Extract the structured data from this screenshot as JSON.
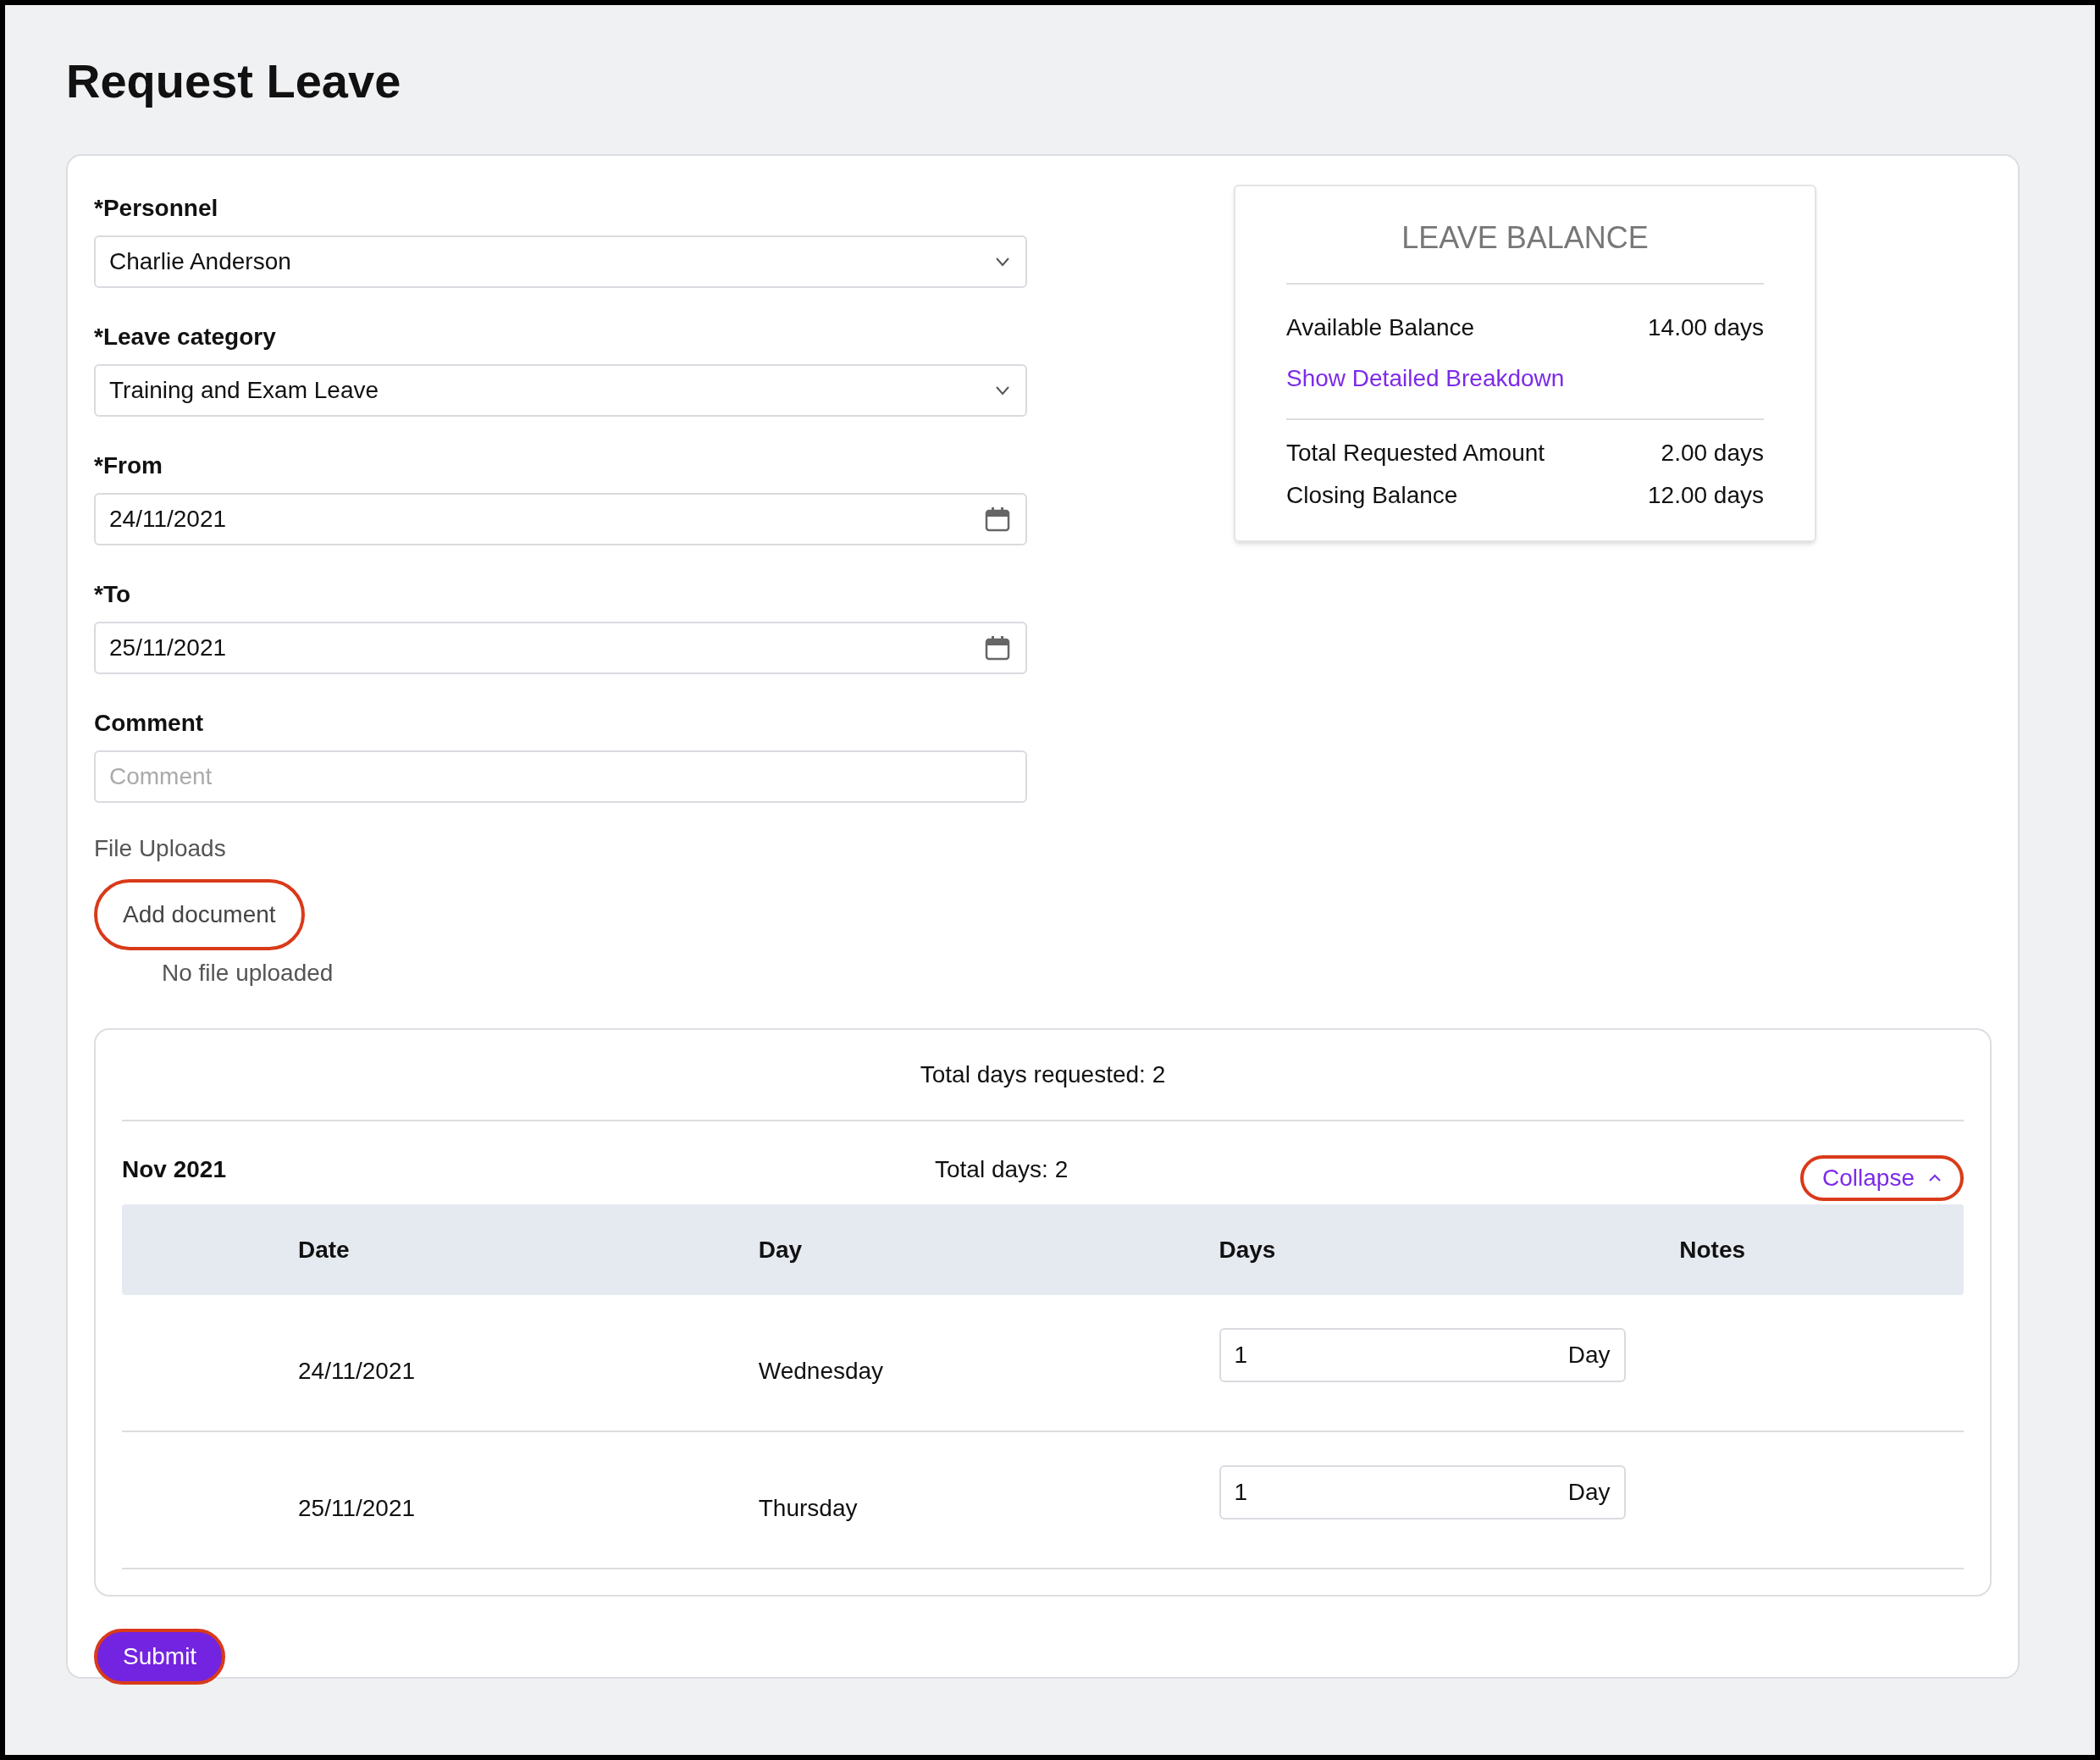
{
  "page_title": "Request Leave",
  "form": {
    "fields": [
      {
        "kind": "select",
        "label": "*Personnel",
        "value": "Charlie Anderson"
      },
      {
        "kind": "select",
        "label": "*Leave category",
        "value": "Training and Exam Leave"
      },
      {
        "kind": "date",
        "label": "*From",
        "value": "24/11/2021"
      },
      {
        "kind": "date",
        "label": "*To",
        "value": "25/11/2021"
      },
      {
        "kind": "text",
        "label": "Comment",
        "placeholder": "Comment"
      }
    ],
    "file_uploads": {
      "label": "File Uploads",
      "button": "Add document",
      "status": "No file uploaded"
    }
  },
  "leave_balance": {
    "title": "LEAVE BALANCE",
    "rows": [
      {
        "label": "Available Balance",
        "value": "14.00 days"
      }
    ],
    "link": "Show Detailed Breakdown",
    "summary_rows": [
      {
        "label": "Total Requested Amount",
        "value": "2.00 days"
      },
      {
        "label": "Closing Balance",
        "value": "12.00 days"
      }
    ]
  },
  "breakdown": {
    "total": "Total days requested: 2",
    "months": [
      {
        "month": "Nov 2021",
        "total": "Total days: 2",
        "toggle": "Collapse",
        "expanded": true,
        "columns": [
          "Date",
          "Day",
          "Days",
          "Notes"
        ],
        "rows": [
          {
            "date": "24/11/2021",
            "day": "Wednesday",
            "days": "1",
            "unit": "Day"
          },
          {
            "date": "25/11/2021",
            "day": "Thursday",
            "days": "1",
            "unit": "Day"
          }
        ]
      }
    ]
  },
  "submit": "Submit"
}
